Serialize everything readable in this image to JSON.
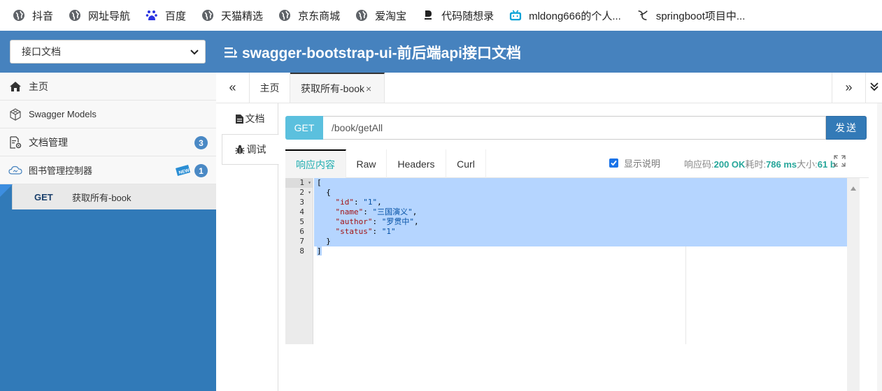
{
  "bookmarks": [
    {
      "label": "抖音",
      "icon": "globe-icon"
    },
    {
      "label": "网址导航",
      "icon": "globe-icon"
    },
    {
      "label": "百度",
      "icon": "baidu-paw-icon"
    },
    {
      "label": "天猫精选",
      "icon": "globe-icon"
    },
    {
      "label": "京东商城",
      "icon": "globe-icon"
    },
    {
      "label": "爱淘宝",
      "icon": "globe-icon"
    },
    {
      "label": "代码随想录",
      "icon": "dm-logo-icon"
    },
    {
      "label": "mldong666的个人...",
      "icon": "bilibili-icon"
    },
    {
      "label": "springboot项目中...",
      "icon": "yuque-icon"
    }
  ],
  "header": {
    "group_select": "接口文档",
    "title": "swagger-bootstrap-ui-前后端api接口文档"
  },
  "sidebar": {
    "items": [
      {
        "label": "主页",
        "icon": "home-icon"
      },
      {
        "label": "Swagger Models",
        "icon": "cube-icon"
      },
      {
        "label": "文档管理",
        "icon": "doc-settings-icon",
        "badge": "3"
      },
      {
        "label": "图书管理控制器",
        "icon": "cloud-icon",
        "badge": "1",
        "tag": "NEW"
      }
    ],
    "api": {
      "method": "GET",
      "label": "获取所有-book"
    }
  },
  "tabs": {
    "prev": "«",
    "home": "主页",
    "active": "获取所有-book",
    "close": "×",
    "next": "»"
  },
  "vtabs": {
    "doc": "文档",
    "debug": "调试"
  },
  "request": {
    "method": "GET",
    "url": "/book/getAll",
    "send": "发送"
  },
  "response": {
    "tabs": [
      "响应内容",
      "Raw",
      "Headers",
      "Curl"
    ],
    "show_desc": "显示说明",
    "code_label": "响应码:",
    "code_value": "200 OK",
    "time_label": "耗时:",
    "time_value": "786 ms",
    "size_label": "大小:",
    "size_value": "61 b",
    "line_numbers": [
      "1",
      "2",
      "3",
      "4",
      "5",
      "6",
      "7",
      "8"
    ],
    "body": {
      "id": "1",
      "name": "三国演义",
      "author": "罗贯中",
      "status": "1"
    }
  },
  "colors": {
    "header_bg": "#4682be",
    "sidebar_bg": "#317ab8",
    "get_badge": "#5bc0de",
    "send_button": "#337ab7",
    "status_green": "#26a69a",
    "selection": "#b5d5ff"
  }
}
